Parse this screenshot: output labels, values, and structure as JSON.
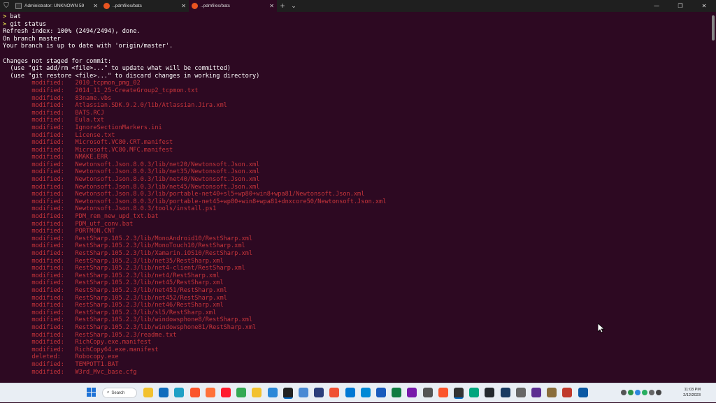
{
  "tabs": [
    {
      "label": "Administrator: UNKNOWN 59",
      "icon": "terminal-icon",
      "active": false
    },
    {
      "label": "..pdmfiles/bats",
      "icon": "ubuntu-icon",
      "active": false
    },
    {
      "label": "..pdmfiles/bats",
      "icon": "ubuntu-icon",
      "active": true
    }
  ],
  "titlebar": {
    "new_tab": "+",
    "dropdown": "⌄",
    "minimize": "—",
    "maximize": "❐",
    "close": "✕"
  },
  "terminal": {
    "head": [
      {
        "prompt": ">",
        "text": " bat"
      },
      {
        "prompt": ">",
        "text": " git status"
      },
      {
        "prompt": "",
        "text": "Refresh index: 100% (2494/2494), done."
      },
      {
        "prompt": "",
        "text": "On branch master"
      },
      {
        "prompt": "",
        "text": "Your branch is up to date with 'origin/master'."
      },
      {
        "prompt": "",
        "text": ""
      },
      {
        "prompt": "",
        "text": "Changes not staged for commit:"
      },
      {
        "prompt": "",
        "text": "  (use \"git add/rm <file>...\" to update what will be committed)"
      },
      {
        "prompt": "",
        "text": "  (use \"git restore <file>...\" to discard changes in working directory)"
      }
    ],
    "files": [
      {
        "status": "modified:",
        "path": "2010_tcpmon_pmg_02"
      },
      {
        "status": "modified:",
        "path": "2014_11_25-CreateGroup2_tcpmon.txt"
      },
      {
        "status": "modified:",
        "path": "83name.vbs"
      },
      {
        "status": "modified:",
        "path": "Atlassian.SDK.9.2.0/lib/Atlassian.Jira.xml"
      },
      {
        "status": "modified:",
        "path": "BATS.RCJ"
      },
      {
        "status": "modified:",
        "path": "Eula.txt"
      },
      {
        "status": "modified:",
        "path": "IgnoreSectionMarkers.ini"
      },
      {
        "status": "modified:",
        "path": "License.txt"
      },
      {
        "status": "modified:",
        "path": "Microsoft.VC80.CRT.manifest"
      },
      {
        "status": "modified:",
        "path": "Microsoft.VC80.MFC.manifest"
      },
      {
        "status": "modified:",
        "path": "NMAKE.ERR"
      },
      {
        "status": "modified:",
        "path": "Newtonsoft.Json.8.0.3/lib/net20/Newtonsoft.Json.xml"
      },
      {
        "status": "modified:",
        "path": "Newtonsoft.Json.8.0.3/lib/net35/Newtonsoft.Json.xml"
      },
      {
        "status": "modified:",
        "path": "Newtonsoft.Json.8.0.3/lib/net40/Newtonsoft.Json.xml"
      },
      {
        "status": "modified:",
        "path": "Newtonsoft.Json.8.0.3/lib/net45/Newtonsoft.Json.xml"
      },
      {
        "status": "modified:",
        "path": "Newtonsoft.Json.8.0.3/lib/portable-net40+sl5+wp80+win8+wpa81/Newtonsoft.Json.xml"
      },
      {
        "status": "modified:",
        "path": "Newtonsoft.Json.8.0.3/lib/portable-net45+wp80+win8+wpa81+dnxcore50/Newtonsoft.Json.xml"
      },
      {
        "status": "modified:",
        "path": "Newtonsoft.Json.8.0.3/tools/install.ps1"
      },
      {
        "status": "modified:",
        "path": "PDM_rem_new_upd_txt.bat"
      },
      {
        "status": "modified:",
        "path": "PDM_utf_conv.bat"
      },
      {
        "status": "modified:",
        "path": "PORTMON.CNT"
      },
      {
        "status": "modified:",
        "path": "RestSharp.105.2.3/lib/MonoAndroid10/RestSharp.xml"
      },
      {
        "status": "modified:",
        "path": "RestSharp.105.2.3/lib/MonoTouch10/RestSharp.xml"
      },
      {
        "status": "modified:",
        "path": "RestSharp.105.2.3/lib/Xamarin.iOS10/RestSharp.xml"
      },
      {
        "status": "modified:",
        "path": "RestSharp.105.2.3/lib/net35/RestSharp.xml"
      },
      {
        "status": "modified:",
        "path": "RestSharp.105.2.3/lib/net4-client/RestSharp.xml"
      },
      {
        "status": "modified:",
        "path": "RestSharp.105.2.3/lib/net4/RestSharp.xml"
      },
      {
        "status": "modified:",
        "path": "RestSharp.105.2.3/lib/net45/RestSharp.xml"
      },
      {
        "status": "modified:",
        "path": "RestSharp.105.2.3/lib/net451/RestSharp.xml"
      },
      {
        "status": "modified:",
        "path": "RestSharp.105.2.3/lib/net452/RestSharp.xml"
      },
      {
        "status": "modified:",
        "path": "RestSharp.105.2.3/lib/net46/RestSharp.xml"
      },
      {
        "status": "modified:",
        "path": "RestSharp.105.2.3/lib/sl5/RestSharp.xml"
      },
      {
        "status": "modified:",
        "path": "RestSharp.105.2.3/lib/windowsphone8/RestSharp.xml"
      },
      {
        "status": "modified:",
        "path": "RestSharp.105.2.3/lib/windowsphone81/RestSharp.xml"
      },
      {
        "status": "modified:",
        "path": "RestSharp.105.2.3/readme.txt"
      },
      {
        "status": "modified:",
        "path": "RichCopy.exe.manifest"
      },
      {
        "status": "modified:",
        "path": "RichCopy64.exe.manifest"
      },
      {
        "status": "deleted:",
        "path": "Robocopy.exe"
      },
      {
        "status": "modified:",
        "path": "TEMPOTT1.BAT"
      },
      {
        "status": "modified:",
        "path": "W3rd_Mvc_base.cfg"
      }
    ]
  },
  "taskbar": {
    "search_label": "Search",
    "apps": [
      "windows-icon",
      "file-explorer-icon",
      "outlook-icon",
      "edge-icon",
      "brave-icon",
      "firefox-icon",
      "opera-icon",
      "chrome-icon",
      "folder-icon",
      "notepad-icon",
      "terminal-icon",
      "photos-icon",
      "powershell-icon",
      "git-icon",
      "vscode-icon",
      "azure-icon",
      "word-icon",
      "excel-icon",
      "onenote-icon",
      "magnifier-icon",
      "brave-alt-icon",
      "windows-terminal-icon",
      "app-icon",
      "github-icon",
      "virtualbox-icon",
      "settings-icon",
      "visualstudio-icon",
      "package-icon",
      "snipping-icon",
      "edge-dev-icon"
    ],
    "time": "11:03 PM",
    "date": "2/12/2023"
  },
  "colors": {
    "terminal_bg": "#2d0922",
    "prompt": "#ffff55",
    "file_path": "#c8353b",
    "text": "#ffffff"
  }
}
